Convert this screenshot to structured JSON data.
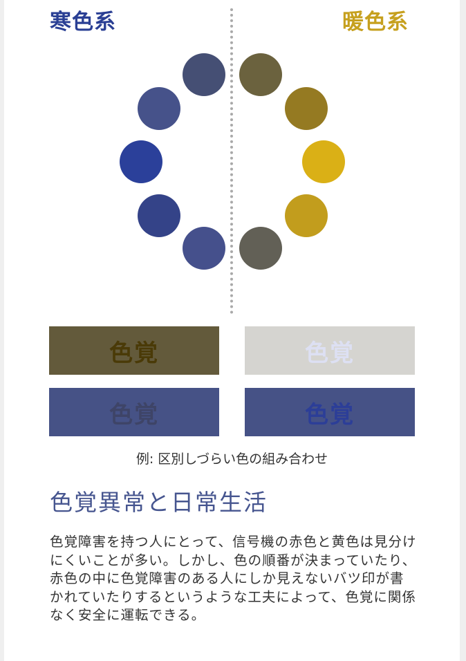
{
  "headings": {
    "cold": "寒色系",
    "warm": "暖色系"
  },
  "palette": {
    "cold": [
      "#454f74",
      "#46528a",
      "#2b409a",
      "#344388",
      "#45508c"
    ],
    "warm": [
      "#6b623e",
      "#957a22",
      "#dab016",
      "#c29d1d",
      "#626056"
    ]
  },
  "swatches": [
    {
      "text": "色覚",
      "bg": "#635a3b",
      "fg": "#4a3a07"
    },
    {
      "text": "色覚",
      "bg": "#d5d4d0",
      "fg": "#dde0f3"
    },
    {
      "text": "色覚",
      "bg": "#465286",
      "fg": "#3e4467"
    },
    {
      "text": "色覚",
      "bg": "#465286",
      "fg": "#2c3e98"
    }
  ],
  "caption": "例: 区別しづらい色の組み合わせ",
  "section": {
    "title": "色覚異常と日常生活",
    "body": "色覚障害を持つ人にとって、信号機の赤色と黄色は見分けにくいことが多い。しかし、色の順番が決まっていたり、赤色の中に色覚障害のある人にしか見えないバツ印が書かれていたりするというような工夫によって、色覚に関係なく安全に運転できる。"
  }
}
